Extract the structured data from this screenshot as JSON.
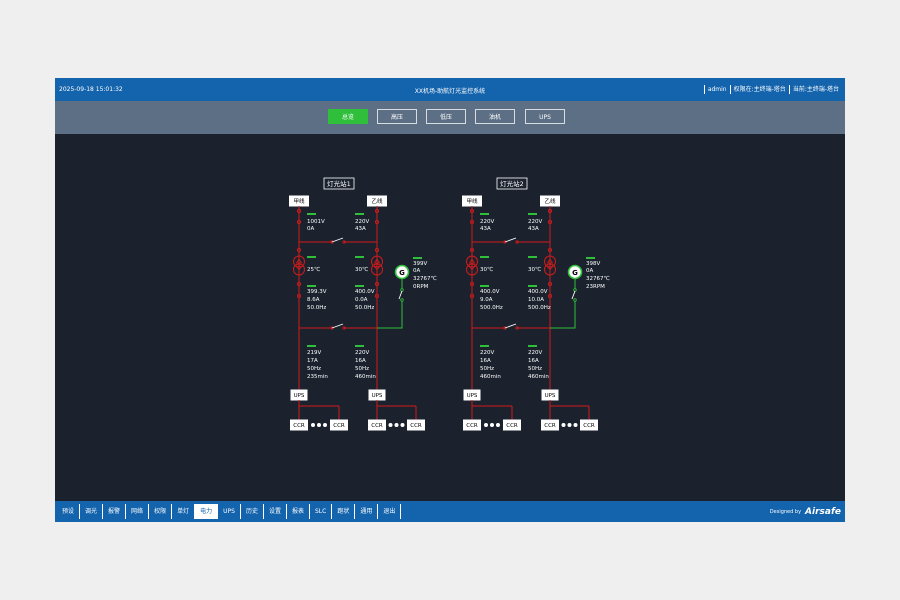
{
  "header": {
    "datetime": "2025-09-18 15:01:32",
    "title": "XX机场-助航灯光监控系统",
    "user": "admin",
    "permission": "权限在:主终端-塔台",
    "current": "当前:主终端-塔台"
  },
  "tabs": [
    {
      "label": "总览",
      "active": true
    },
    {
      "label": "高压"
    },
    {
      "label": "低压"
    },
    {
      "label": "油机"
    },
    {
      "label": "UPS"
    }
  ],
  "labels": {
    "line_a": "甲线",
    "line_b": "乙线",
    "gen": "G",
    "ups": "UPS",
    "ccr": "CCR"
  },
  "stations": [
    {
      "name": "灯光站1",
      "left_in": [
        "1001V",
        "0A"
      ],
      "right_in": [
        "220V",
        "43A"
      ],
      "left_temp": "25℃",
      "right_temp": "30℃",
      "gen": [
        "399V",
        "0A",
        "32767℃",
        "0RPM"
      ],
      "left_mid": [
        "399.3V",
        "8.6A",
        "50.0Hz"
      ],
      "right_mid": [
        "400.0V",
        "0.0A",
        "50.0Hz"
      ],
      "left_ups": [
        "219V",
        "17A",
        "50Hz",
        "235min"
      ],
      "right_ups": [
        "220V",
        "16A",
        "50Hz",
        "460min"
      ]
    },
    {
      "name": "灯光站2",
      "left_in": [
        "220V",
        "43A"
      ],
      "right_in": [
        "220V",
        "43A"
      ],
      "left_temp": "30℃",
      "right_temp": "30℃",
      "gen": [
        "398V",
        "0A",
        "32767℃",
        "23RPM"
      ],
      "left_mid": [
        "400.0V",
        "9.0A",
        "500.0Hz"
      ],
      "right_mid": [
        "400.0V",
        "10.0A",
        "500.0Hz"
      ],
      "left_ups": [
        "220V",
        "16A",
        "50Hz",
        "460min"
      ],
      "right_ups": [
        "220V",
        "16A",
        "50Hz",
        "460min"
      ]
    }
  ],
  "nav": [
    {
      "label": "预设"
    },
    {
      "label": "调光"
    },
    {
      "label": "报警"
    },
    {
      "label": "网络"
    },
    {
      "label": "权限"
    },
    {
      "label": "单灯"
    },
    {
      "label": "电力",
      "active": true
    },
    {
      "label": "UPS"
    },
    {
      "label": "历史"
    },
    {
      "label": "设置"
    },
    {
      "label": "报表"
    },
    {
      "label": "SLC"
    },
    {
      "label": "跑状"
    },
    {
      "label": "通用"
    },
    {
      "label": "退出"
    }
  ],
  "footer": {
    "designed": "Designed by",
    "brand": "Airsafe"
  },
  "colors": {
    "bus": "#d01b1b",
    "active": "#2fbf3a",
    "topbar": "#1363ad"
  }
}
